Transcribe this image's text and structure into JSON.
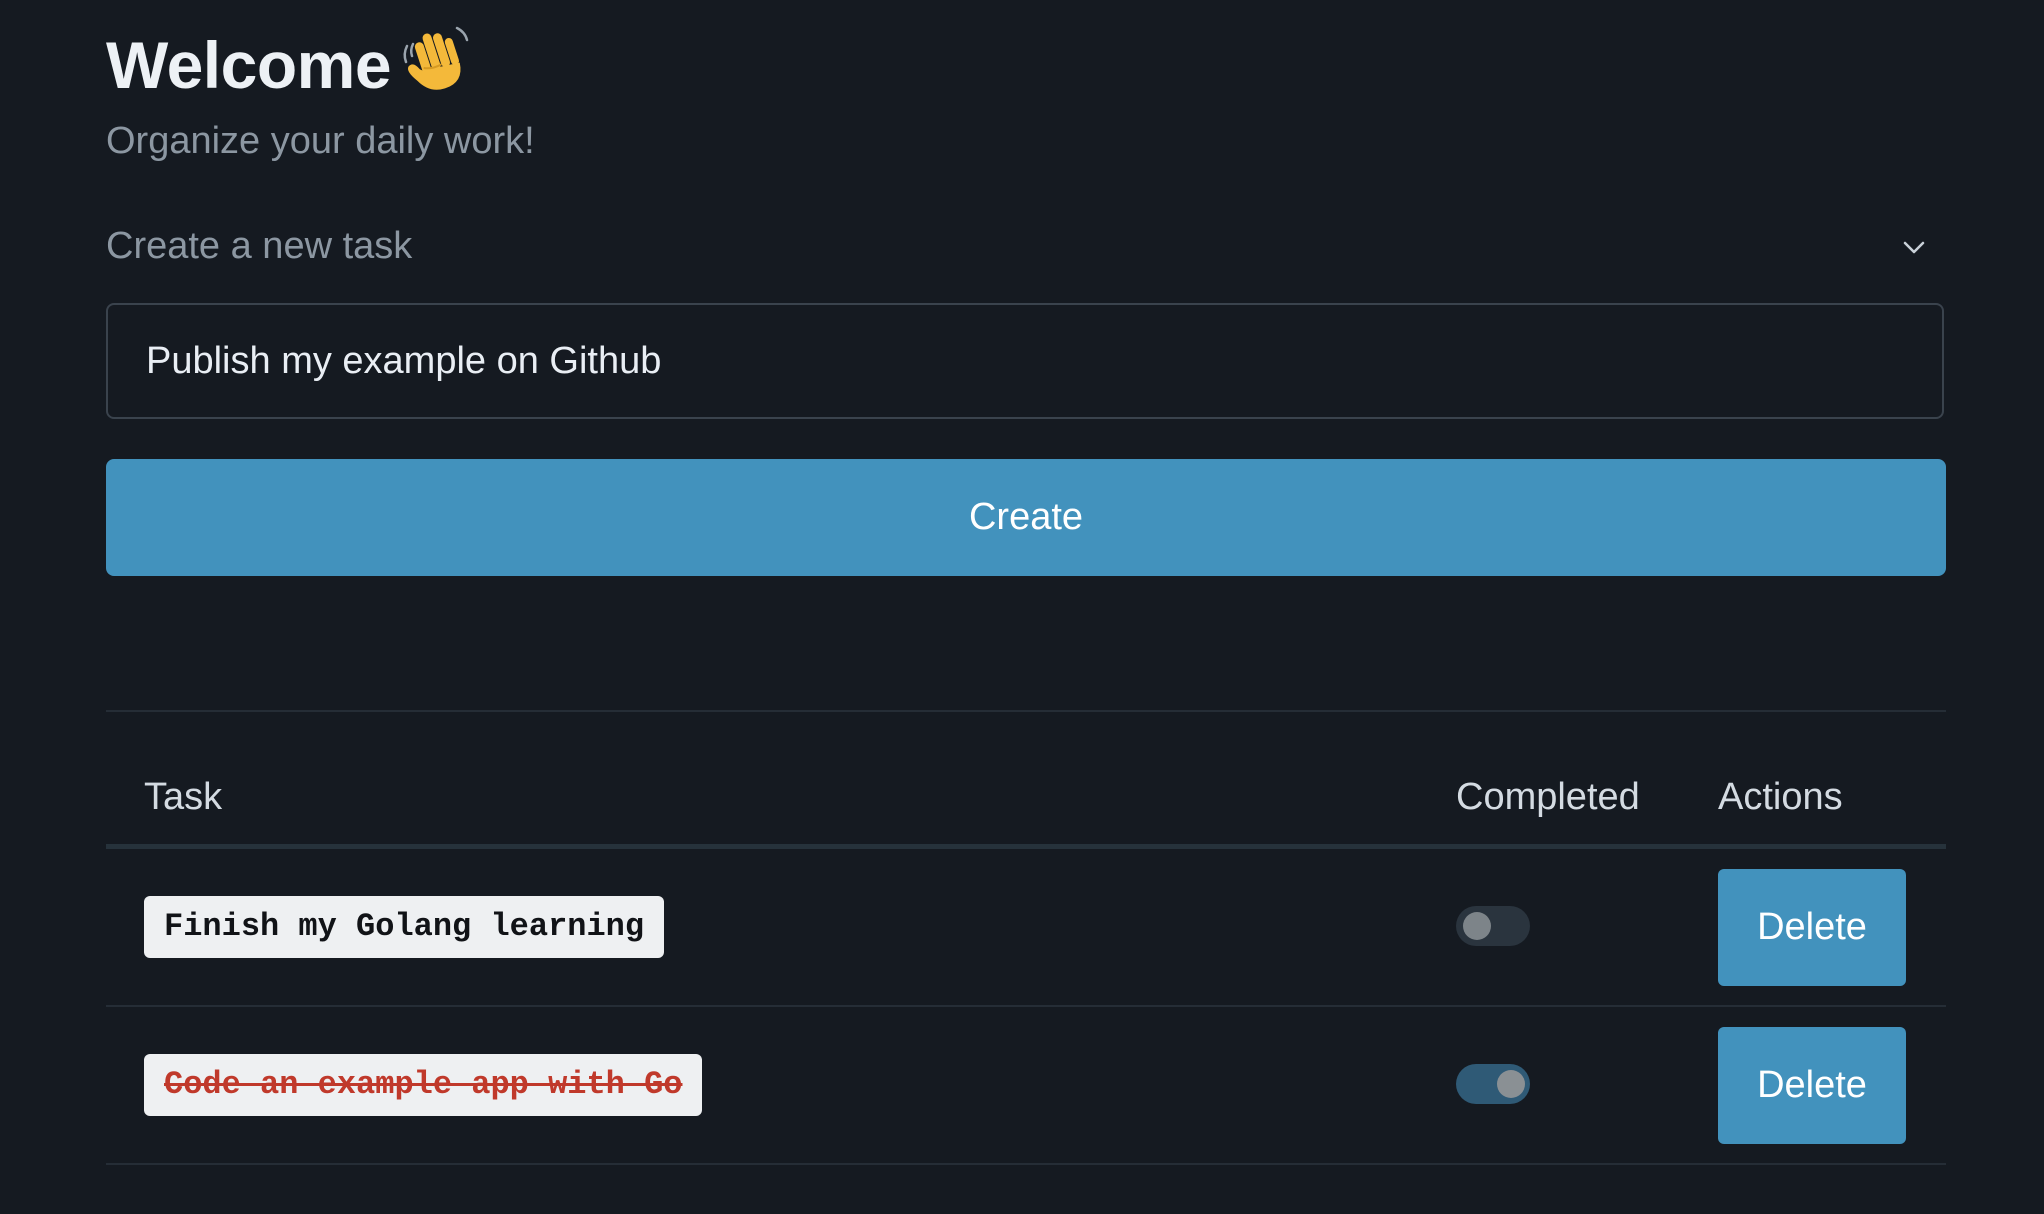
{
  "header": {
    "title": "Welcome",
    "title_icon": "waving-hand-emoji",
    "subtitle": "Organize your daily work!"
  },
  "create_section": {
    "collapse_label": "Create a new task",
    "collapse_icon": "chevron-down-icon",
    "input_value": "Publish my example on Github",
    "create_button_label": "Create"
  },
  "table": {
    "columns": [
      "Task",
      "Completed",
      "Actions"
    ],
    "rows": [
      {
        "task": "Finish my Golang learning",
        "completed": false,
        "action_label": "Delete"
      },
      {
        "task": "Code an example app with Go",
        "completed": true,
        "action_label": "Delete"
      }
    ]
  },
  "colors": {
    "background": "#151a21",
    "accent": "#4292bd",
    "completed_text": "#c0392b"
  }
}
